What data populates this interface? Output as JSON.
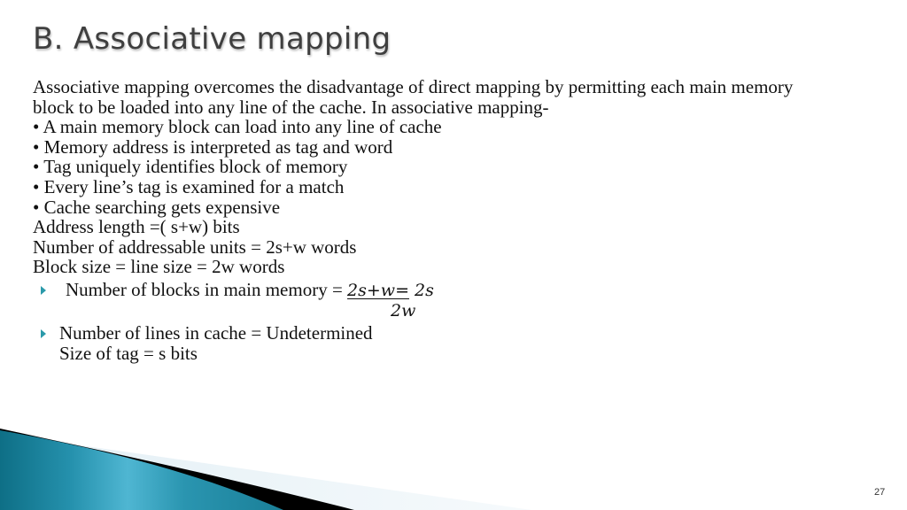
{
  "slide": {
    "title": "B. Associative mapping",
    "page_number": "27",
    "accent_color": "#2b9aaa"
  },
  "body": {
    "paragraph_lines": [
      "Associative mapping overcomes the disadvantage of direct mapping by permitting each main memory",
      "block to be loaded into any line of the cache. In associative mapping-"
    ],
    "bullets": [
      "• A main memory block can load into any line of cache",
      "• Memory address is interpreted as tag and word",
      "• Tag uniquely identifies block of memory",
      "• Every line’s tag is examined for a match",
      "• Cache searching gets expensive"
    ],
    "formulas": [
      "Address length =( s+w) bits",
      "Number of addressable units = 2s+w words",
      "Block size = line size = 2w words"
    ]
  },
  "arrow_items": [
    {
      "label": "Number of blocks in main memory = ",
      "math_numerator": "2s+w=",
      "math_result": " 2s",
      "math_denominator": "2w"
    },
    {
      "line1": "Number of lines in cache = Undetermined",
      "line2": "Size of tag = s bits"
    }
  ]
}
